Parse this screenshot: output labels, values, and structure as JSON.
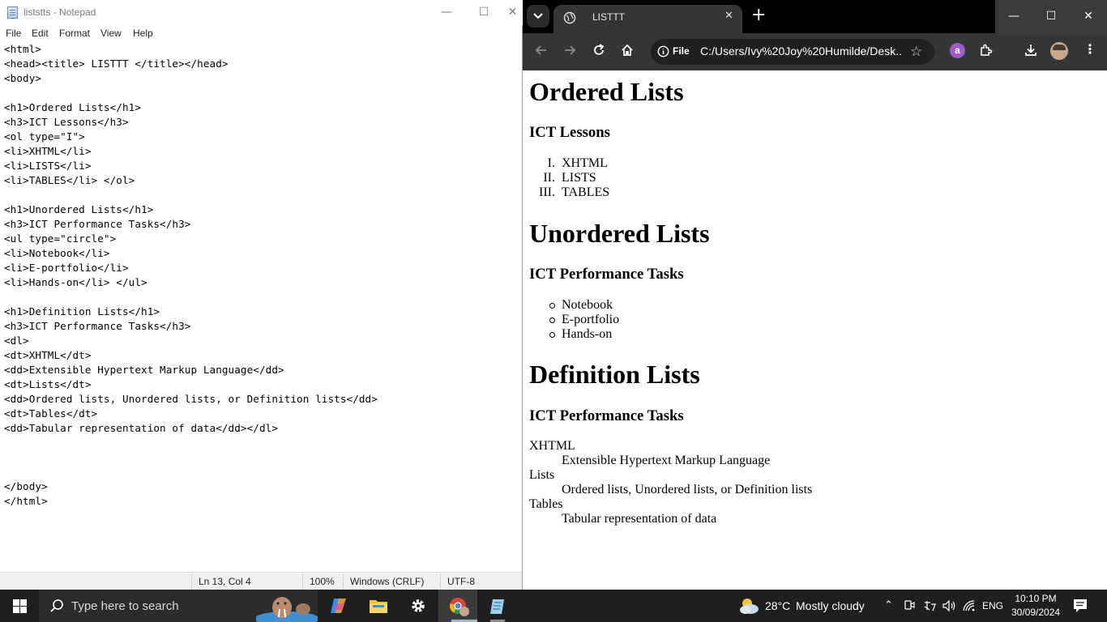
{
  "notepad": {
    "title": "liststts - Notepad",
    "menu": [
      "File",
      "Edit",
      "Format",
      "View",
      "Help"
    ],
    "lines": [
      "<html>",
      "<head><title> LISTTT </title></head>",
      "<body>",
      "",
      "<h1>Ordered Lists</h1>",
      "<h3>ICT Lessons</h3>",
      "<ol type=\"I\">",
      "<li>XHTML</li>",
      "<li>LISTS</li>",
      "<li>TABLES</li> </ol>",
      "",
      "<h1>Unordered Lists</h1>",
      "<h3>ICT Performance Tasks</h3>",
      "<ul type=\"circle\">",
      "<li>Notebook</li>",
      "<li>E-portfolio</li>",
      "<li>Hands-on</li> </ul>",
      "",
      "<h1>Definition Lists</h1>",
      "<h3>ICT Performance Tasks</h3>",
      "<dl>",
      "<dt>XHTML</dt>",
      "<dd>Extensible Hypertext Markup Language</dd>",
      "<dt>Lists</dt>",
      "<dd>Ordered lists, Unordered lists, or Definition lists</dd>",
      "<dt>Tables</dt>",
      "<dd>Tabular representation of data</dd></dl>",
      "",
      "",
      "",
      "</body>",
      "</html>"
    ],
    "status": {
      "position": "Ln 13, Col 4",
      "zoom": "100%",
      "line_ending": "Windows (CRLF)",
      "encoding": "UTF-8"
    }
  },
  "chrome": {
    "tab_title": "LISTTT",
    "chip": "File",
    "url": "C:/Users/Ivy%20Joy%20Humilde/Desk...",
    "extension_letter": "a"
  },
  "page": {
    "sections": [
      {
        "h1": "Ordered Lists",
        "h3": "ICT Lessons",
        "markers": [
          "I.",
          "II.",
          "III."
        ],
        "items": [
          "XHTML",
          "LISTS",
          "TABLES"
        ]
      },
      {
        "h1": "Unordered Lists",
        "h3": "ICT Performance Tasks",
        "items": [
          "Notebook",
          "E-portfolio",
          "Hands-on"
        ]
      },
      {
        "h1": "Definition Lists",
        "h3": "ICT Performance Tasks",
        "dl": [
          {
            "dt": "XHTML",
            "dd": "Extensible Hypertext Markup Language"
          },
          {
            "dt": "Lists",
            "dd": "Ordered lists, Unordered lists, or Definition lists"
          },
          {
            "dt": "Tables",
            "dd": "Tabular representation of data"
          }
        ]
      }
    ]
  },
  "taskbar": {
    "search_placeholder": "Type here to search",
    "temperature": "28°C",
    "weather": "Mostly cloudy",
    "language": "ENG",
    "time": "10:10 PM",
    "date": "30/09/2024"
  }
}
